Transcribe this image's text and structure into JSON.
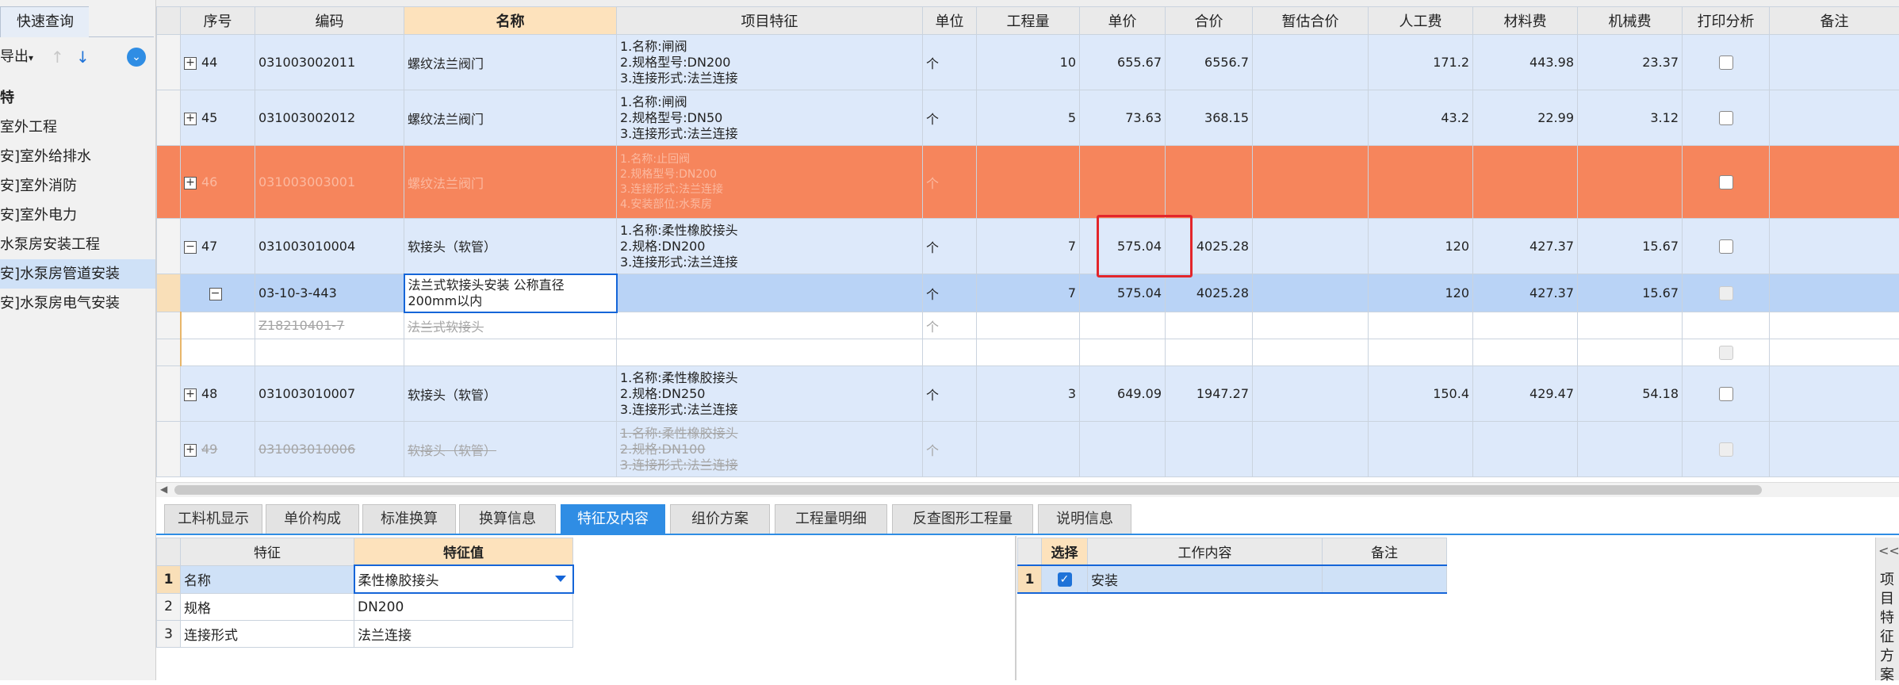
{
  "left_panel": {
    "tab_label": "快速查询",
    "export_label": "导出",
    "tree": [
      {
        "label": "特",
        "bold": true
      },
      {
        "label": "室外工程"
      },
      {
        "label": "安]室外给排水"
      },
      {
        "label": "安]室外消防"
      },
      {
        "label": "安]室外电力"
      },
      {
        "label": "水泵房安装工程"
      },
      {
        "label": "安]水泵房管道安装",
        "selected": true
      },
      {
        "label": "安]水泵房电气安装"
      }
    ]
  },
  "grid": {
    "headers": [
      "序号",
      "编码",
      "名称",
      "项目特征",
      "单位",
      "工程量",
      "单价",
      "合价",
      "暂估合价",
      "人工费",
      "材料费",
      "机械费",
      "打印分析",
      "备注"
    ],
    "rows": [
      {
        "seq": "44",
        "code": "031003002011",
        "name": "螺纹法兰阀门",
        "feature": [
          "1.名称:闸阀",
          "2.规格型号:DN200",
          "3.连接形式:法兰连接"
        ],
        "unit": "个",
        "qty": "10",
        "price": "655.67",
        "total": "6556.7",
        "labor": "171.2",
        "material": "443.98",
        "machine": "23.37"
      },
      {
        "seq": "45",
        "code": "031003002012",
        "name": "螺纹法兰阀门",
        "feature": [
          "1.名称:闸阀",
          "2.规格型号:DN50",
          "3.连接形式:法兰连接"
        ],
        "unit": "个",
        "qty": "5",
        "price": "73.63",
        "total": "368.15",
        "labor": "43.2",
        "material": "22.99",
        "machine": "3.12"
      },
      {
        "seq": "46",
        "code": "031003003001",
        "name": "螺纹法兰阀门",
        "feature": [
          "1.名称:止回阀",
          "2.规格型号:DN200",
          "3.连接形式:法兰连接",
          "4.安装部位:水泵房"
        ],
        "unit": "个"
      },
      {
        "seq": "47",
        "code": "031003010004",
        "name": "软接头（软管）",
        "feature": [
          "1.名称:柔性橡胶接头",
          "2.规格:DN200",
          "3.连接形式:法兰连接"
        ],
        "unit": "个",
        "qty": "7",
        "price": "575.04",
        "total": "4025.28",
        "labor": "120",
        "material": "427.37",
        "machine": "15.67"
      },
      {
        "code": "03-10-3-443",
        "name": "法兰式软接头安装 公称直径200mm以内",
        "unit": "个",
        "qty": "7",
        "price": "575.04",
        "total": "4025.28",
        "labor": "120",
        "material": "427.37",
        "machine": "15.67"
      },
      {
        "code": "Z18210401-7",
        "name": "法兰式软接头",
        "unit": "个"
      },
      {},
      {
        "seq": "48",
        "code": "031003010007",
        "name": "软接头（软管）",
        "feature": [
          "1.名称:柔性橡胶接头",
          "2.规格:DN250",
          "3.连接形式:法兰连接"
        ],
        "unit": "个",
        "qty": "3",
        "price": "649.09",
        "total": "1947.27",
        "labor": "150.4",
        "material": "429.47",
        "machine": "54.18"
      },
      {
        "seq": "49",
        "code": "031003010006",
        "name": "软接头（软管）",
        "feature": [
          "1.名称:柔性橡胶接头",
          "2.规格:DN100",
          "3.连接形式:法兰连接"
        ],
        "unit": "个"
      }
    ]
  },
  "bottom_tabs": [
    "工料机显示",
    "单价构成",
    "标准换算",
    "换算信息",
    "特征及内容",
    "组价方案",
    "工程量明细",
    "反查图形工程量",
    "说明信息"
  ],
  "active_tab": "特征及内容",
  "feature_table": {
    "headers": [
      "特征",
      "特征值"
    ],
    "rows": [
      {
        "n": "1",
        "name": "名称",
        "value": "柔性橡胶接头"
      },
      {
        "n": "2",
        "name": "规格",
        "value": "DN200"
      },
      {
        "n": "3",
        "name": "连接形式",
        "value": "法兰连接"
      }
    ]
  },
  "work_table": {
    "headers": [
      "选择",
      "工作内容",
      "备注"
    ],
    "rows": [
      {
        "n": "1",
        "content": "安装",
        "note": ""
      }
    ]
  },
  "right_panel": {
    "toggle": "<<",
    "label": "项目特征方案"
  },
  "colors": {
    "accent": "#2f8de4",
    "row_blue": "#dde9fa",
    "row_orange": "#f6855c",
    "highlight_red": "#e3262b"
  }
}
